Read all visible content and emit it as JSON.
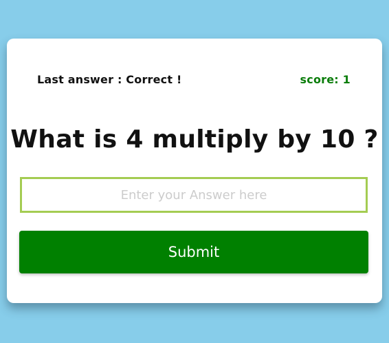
{
  "status": {
    "last_answer": "Last answer : Correct !",
    "score": "score: 1"
  },
  "question": {
    "text": "What is 4 multiply by 10 ?"
  },
  "answer_input": {
    "placeholder": "Enter your Answer here",
    "value": ""
  },
  "submit": {
    "label": "Submit"
  },
  "colors": {
    "background": "#87cdea",
    "card": "#ffffff",
    "score_text": "#0a7d0a",
    "input_border": "#a4cc52",
    "submit_button": "#008000",
    "submit_text": "#ffffff"
  }
}
